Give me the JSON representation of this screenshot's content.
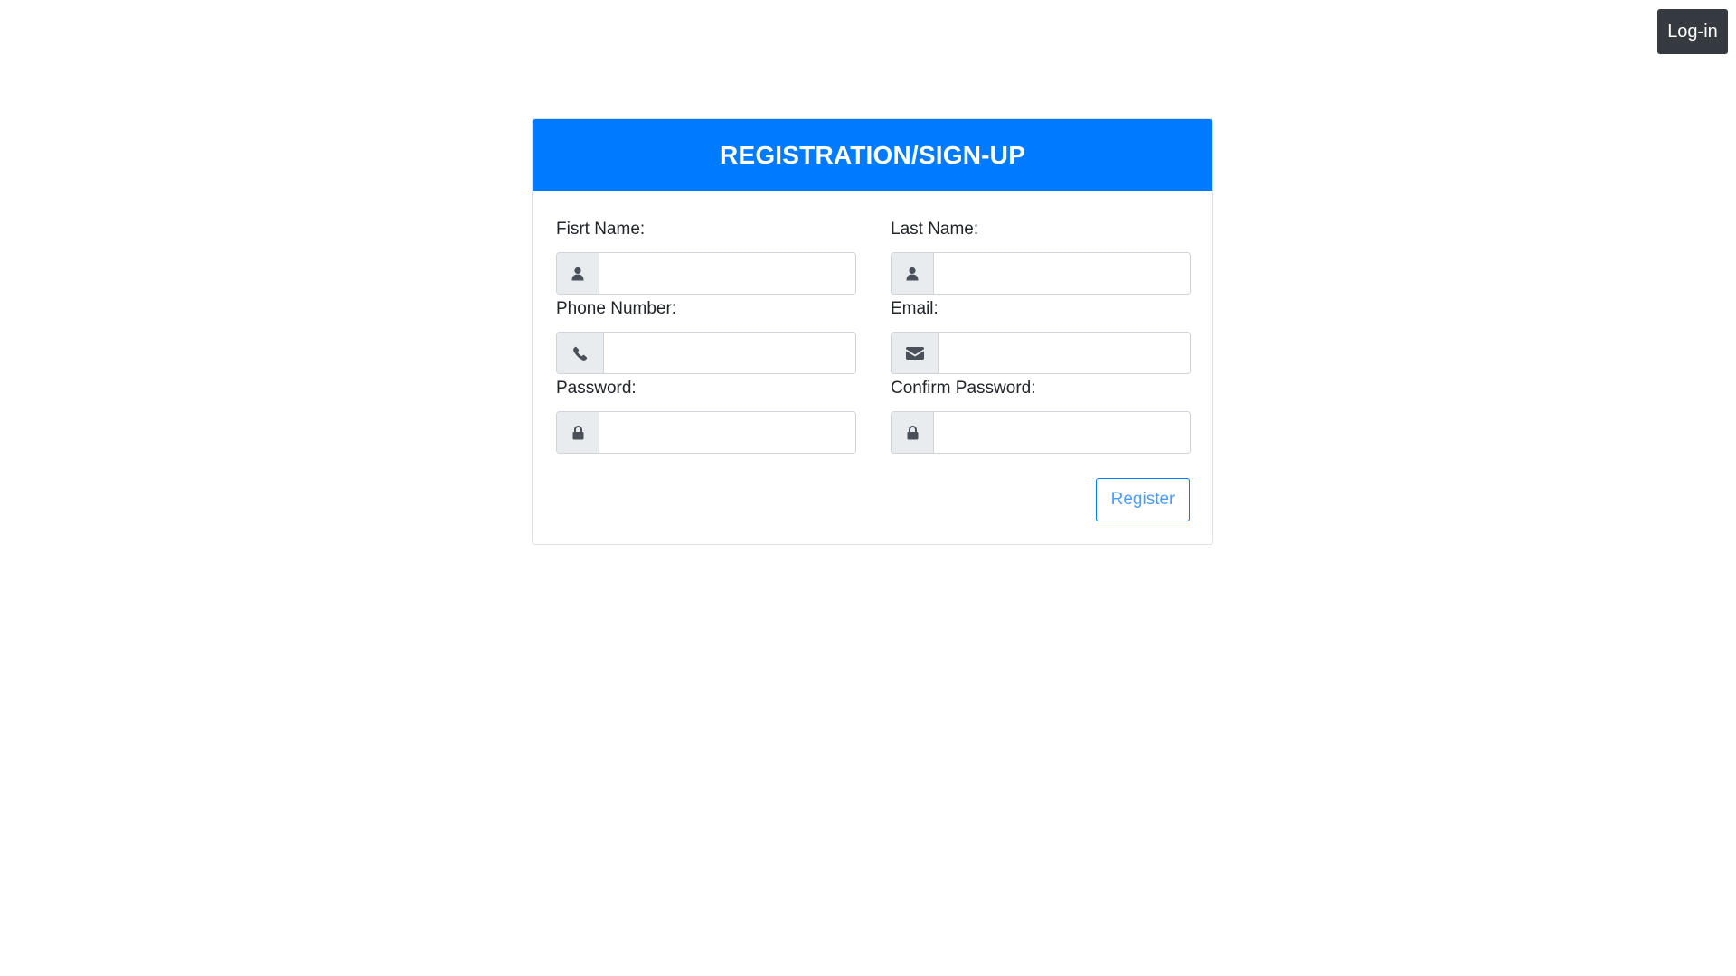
{
  "header": {
    "login_label": "Log-in"
  },
  "form": {
    "title": "REGISTRATION/SIGN-UP",
    "fields": {
      "first_name": {
        "label": "Fisrt Name:",
        "value": "",
        "icon": "user-icon"
      },
      "last_name": {
        "label": "Last Name:",
        "value": "",
        "icon": "user-icon"
      },
      "phone": {
        "label": "Phone Number:",
        "value": "",
        "icon": "phone-icon"
      },
      "email": {
        "label": "Email:",
        "value": "",
        "icon": "envelope-icon"
      },
      "password": {
        "label": "Password:",
        "value": "",
        "icon": "lock-icon"
      },
      "confirm_password": {
        "label": "Confirm Password:",
        "value": "",
        "icon": "lock-icon"
      }
    },
    "submit_label": "Register"
  },
  "colors": {
    "primary": "#007bff",
    "dark_button": "#343a40",
    "addon_bg": "#e9ecef",
    "icon": "#495057"
  }
}
